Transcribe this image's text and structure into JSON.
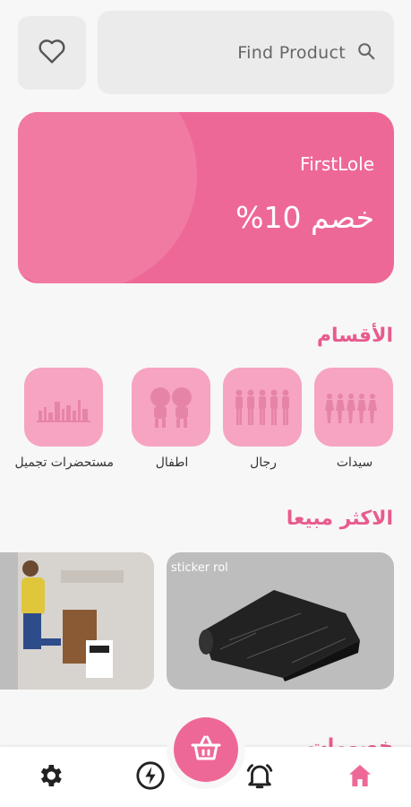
{
  "search": {
    "placeholder": "Find Product",
    "icon": "search-icon"
  },
  "favorites": {
    "icon": "heart-icon"
  },
  "banner": {
    "shop_name": "FirstLole",
    "promo_text": "خصم 10%",
    "color": "#ee6897"
  },
  "categories": {
    "title": "الأقسام",
    "items": [
      {
        "label": "سيدات"
      },
      {
        "label": "رجال"
      },
      {
        "label": "اطفال"
      },
      {
        "label": "مستحضرات تجميل"
      }
    ]
  },
  "best_sellers": {
    "title": "الاكثر مبيعا",
    "items": [
      {
        "title": "sticker rol"
      },
      {
        "title": ""
      }
    ]
  },
  "offers": {
    "title": "خصومات"
  },
  "bottom_nav": {
    "items": [
      {
        "icon": "gear-icon"
      },
      {
        "icon": "lightning-icon"
      },
      {
        "icon": "bell-icon"
      },
      {
        "icon": "home-icon",
        "active": true
      }
    ],
    "center_icon": "basket-icon"
  },
  "colors": {
    "accent": "#ee6897",
    "tile": "#f6a4c1",
    "title": "#e85b8e"
  }
}
